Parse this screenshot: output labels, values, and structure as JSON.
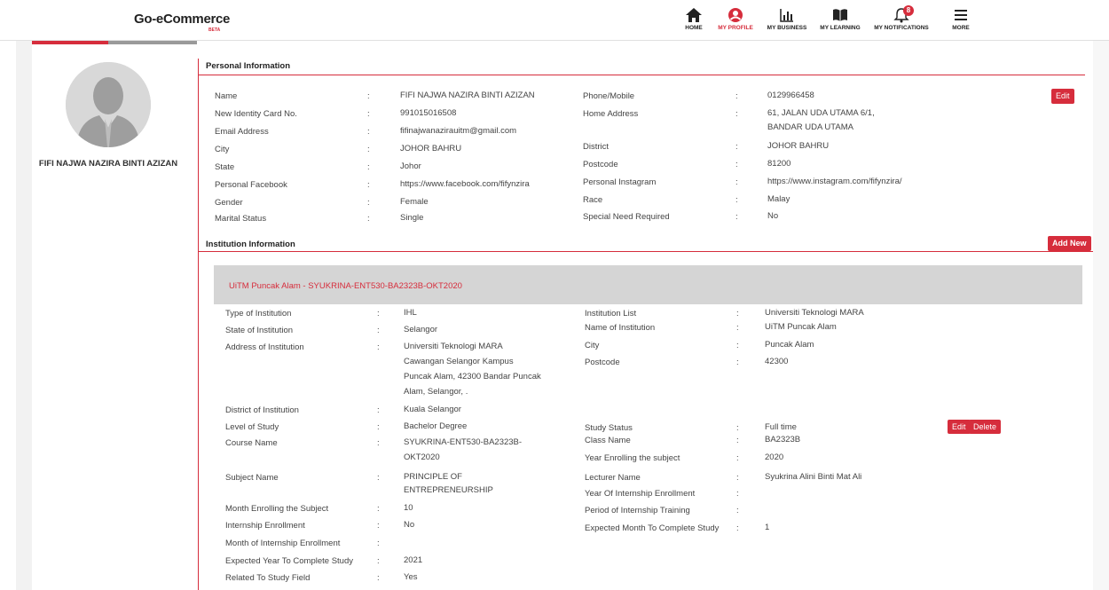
{
  "brand": {
    "name": "Go-eCommerce",
    "tag": "BETA"
  },
  "nav": [
    {
      "label": "HOME",
      "icon": "home-icon"
    },
    {
      "label": "MY PROFILE",
      "icon": "profile-icon"
    },
    {
      "label": "MY BUSINESS",
      "icon": "chart-icon"
    },
    {
      "label": "MY LEARNING",
      "icon": "book-icon"
    },
    {
      "label": "MY NOTIFICATIONS",
      "icon": "bell-icon",
      "badge": "8"
    },
    {
      "label": "MORE",
      "icon": "menu-icon"
    }
  ],
  "profile": {
    "display_name": "FIFI NAJWA NAZIRA BINTI AZIZAN"
  },
  "personal": {
    "title": "Personal Information",
    "edit": "Edit",
    "left": [
      {
        "label": "Name",
        "value": "FIFI NAJWA NAZIRA BINTI AZIZAN"
      },
      {
        "label": "New Identity Card No.",
        "value": "991015016508"
      },
      {
        "label": "Email Address",
        "value": "fifinajwanazirauitm@gmail.com"
      },
      {
        "label": "City",
        "value": "JOHOR BAHRU"
      },
      {
        "label": "State",
        "value": "Johor"
      },
      {
        "label": "Personal Facebook",
        "value": "https://www.facebook.com/fifynzira"
      },
      {
        "label": "Gender",
        "value": "Female"
      },
      {
        "label": "Marital Status",
        "value": "Single"
      }
    ],
    "right": [
      {
        "label": "Phone/Mobile",
        "value": "0129966458"
      },
      {
        "label": "Home Address",
        "value": "61, JALAN UDA UTAMA 6/1,",
        "value2": "BANDAR UDA UTAMA"
      },
      {
        "label": "District",
        "value": "JOHOR BAHRU"
      },
      {
        "label": "Postcode",
        "value": "81200"
      },
      {
        "label": "Personal Instagram",
        "value": "https://www.instagram.com/fifynzira/"
      },
      {
        "label": "Race",
        "value": "Malay"
      },
      {
        "label": "Special Need Required",
        "value": "No"
      }
    ]
  },
  "institution": {
    "title": "Institution Information",
    "add_new": "Add New",
    "header": "UiTM Puncak Alam - SYUKRINA-ENT530-BA2323B-OKT2020",
    "edit": "Edit",
    "delete": "Delete",
    "left": [
      {
        "label": "Type of Institution",
        "value": "IHL"
      },
      {
        "label": "State of Institution",
        "value": "Selangor"
      },
      {
        "label": "Address of Institution",
        "value": "Universiti Teknologi MARA",
        "value2": "Cawangan Selangor Kampus",
        "value3": "Puncak Alam, 42300 Bandar Puncak",
        "value4": "Alam, Selangor, ."
      },
      {
        "label": "District of Institution",
        "value": "Kuala Selangor"
      },
      {
        "label": "Level of Study",
        "value": "Bachelor Degree"
      },
      {
        "label": "Course Name",
        "value": "SYUKRINA-ENT530-BA2323B-",
        "value2": "OKT2020"
      },
      {
        "label": "Subject Name",
        "value": "PRINCIPLE OF",
        "value2": "ENTREPRENEURSHIP"
      },
      {
        "label": "Month Enrolling the Subject",
        "value": "10"
      },
      {
        "label": "Internship Enrollment",
        "value": "No"
      },
      {
        "label": "Month of Internship Enrollment",
        "value": ""
      },
      {
        "label": "Expected Year To Complete Study",
        "value": "2021"
      },
      {
        "label": "Related To Study Field",
        "value": "Yes"
      }
    ],
    "right": [
      {
        "label": "Institution List",
        "value": "Universiti Teknologi MARA"
      },
      {
        "label": "Name of Institution",
        "value": "UiTM Puncak Alam"
      },
      {
        "label": "City",
        "value": "Puncak Alam"
      },
      {
        "label": "Postcode",
        "value": "42300"
      },
      {
        "label": "Study Status",
        "value": "Full time"
      },
      {
        "label": "Class Name",
        "value": "BA2323B"
      },
      {
        "label": "Year Enrolling the subject",
        "value": "2020"
      },
      {
        "label": "Lecturer Name",
        "value": "Syukrina Alini Binti Mat Ali"
      },
      {
        "label": "Year Of Internship Enrollment",
        "value": ""
      },
      {
        "label": "Period of Internship Training",
        "value": ""
      },
      {
        "label": "Expected Month To Complete Study",
        "value": "1"
      }
    ]
  },
  "colon": ":"
}
